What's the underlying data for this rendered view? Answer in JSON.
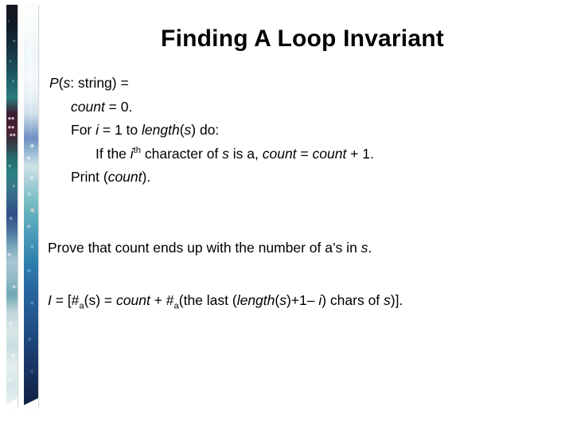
{
  "slide": {
    "title": "Finding A Loop Invariant",
    "background_color": "#ffffff",
    "text_color": "#000000"
  },
  "decoration": {
    "left_border_name": "decorative-border-strips",
    "strip_colors": [
      "#13161f",
      "#2b7b7c",
      "#3a1f33",
      "#2f4d86",
      "#eef5f6",
      "#101f3f",
      "#63b0be"
    ]
  },
  "code": {
    "line1": {
      "p": "P",
      "open": "(",
      "s": "s",
      "rest": ": string) ="
    },
    "line2": {
      "count": "count",
      "rest": " = 0."
    },
    "line3": {
      "for": "For ",
      "i": "i",
      "mid": " = 1 to ",
      "length": "length",
      "open": "(",
      "s": "s",
      "close": ") do:"
    },
    "line4": {
      "ifthe": "If the ",
      "i": "i",
      "th": "th",
      "charof": " character of ",
      "s": "s",
      "isa": " is a, ",
      "count1": "count",
      "eq": " = ",
      "count2": "count",
      "plus": " + 1."
    },
    "line5": {
      "print": "Print (",
      "count": "count",
      "close": ")."
    }
  },
  "prove": {
    "text": "Prove that count ends up with the number of a’s in ",
    "s": "s",
    "period": "."
  },
  "invariant": {
    "I": "I",
    "eq1": " = [#",
    "sub_a1": "a",
    "s1": "(s",
    "eq2": ") = ",
    "count": "count",
    "plus": " + #",
    "sub_a2": "a",
    "thelast": "(the last (",
    "length": "length",
    "openS": "(",
    "s2": "s",
    "plus1": ")+1– ",
    "i": "i",
    "chars": ") chars of ",
    "s3": "s",
    "end": ")]."
  }
}
